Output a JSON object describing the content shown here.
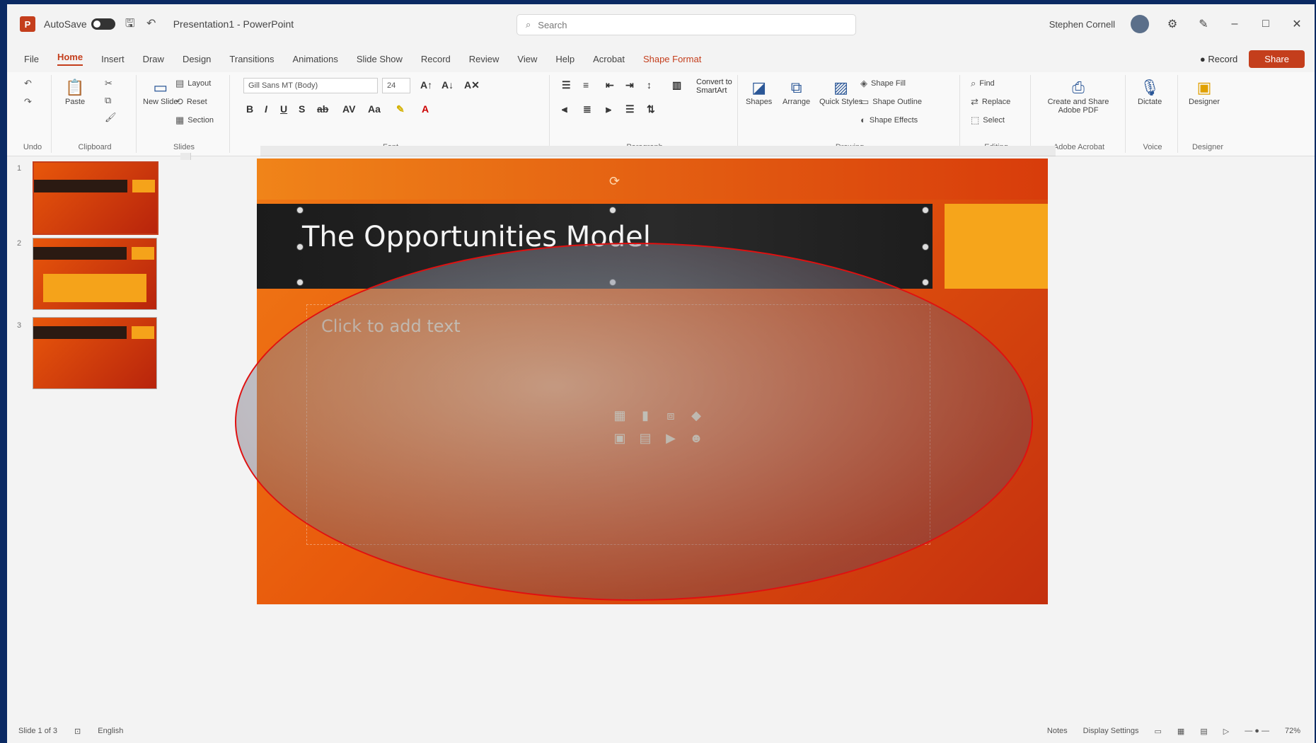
{
  "titlebar": {
    "app_letter": "P",
    "autosave_label": "AutoSave",
    "doc_title": "Presentation1 - PowerPoint",
    "search_placeholder": "Search",
    "user_name": "Stephen Cornell",
    "minimize": "–",
    "maximize": "□",
    "close": "✕"
  },
  "tabs": {
    "items": [
      "File",
      "Home",
      "Insert",
      "Draw",
      "Design",
      "Transitions",
      "Animations",
      "Slide Show",
      "Record",
      "Review",
      "View",
      "Help",
      "Acrobat",
      "Shape Format"
    ],
    "record_label": "Record",
    "share_label": "Share"
  },
  "ribbon": {
    "groups": [
      "Undo",
      "Clipboard",
      "Slides",
      "Font",
      "Paragraph",
      "Drawing",
      "Editing",
      "Adobe Acrobat",
      "Voice",
      "Designer"
    ],
    "paste": "Paste",
    "new_slide": "New Slide",
    "layout": "Layout",
    "reset": "Reset",
    "section": "Section",
    "font_name": "Gill Sans MT (Body)",
    "font_size": "24",
    "convert_smartart": "Convert to SmartArt",
    "shapes": "Shapes",
    "arrange": "Arrange",
    "quick_styles": "Quick Styles",
    "shape_fill": "Shape Fill",
    "shape_outline": "Shape Outline",
    "shape_effects": "Shape Effects",
    "find": "Find",
    "replace": "Replace",
    "select": "Select",
    "create_pdf": "Create and Share Adobe PDF",
    "dictate": "Dictate",
    "designer": "Designer"
  },
  "slides_panel": {
    "numbers": [
      "1",
      "2",
      "3"
    ]
  },
  "slide": {
    "title": "The Opportunities Model",
    "bullet": "Click to add text"
  },
  "status": {
    "slide_info": "Slide 1 of 3",
    "language": "English",
    "notes": "Notes",
    "display": "Display Settings",
    "zoom": "72%"
  }
}
